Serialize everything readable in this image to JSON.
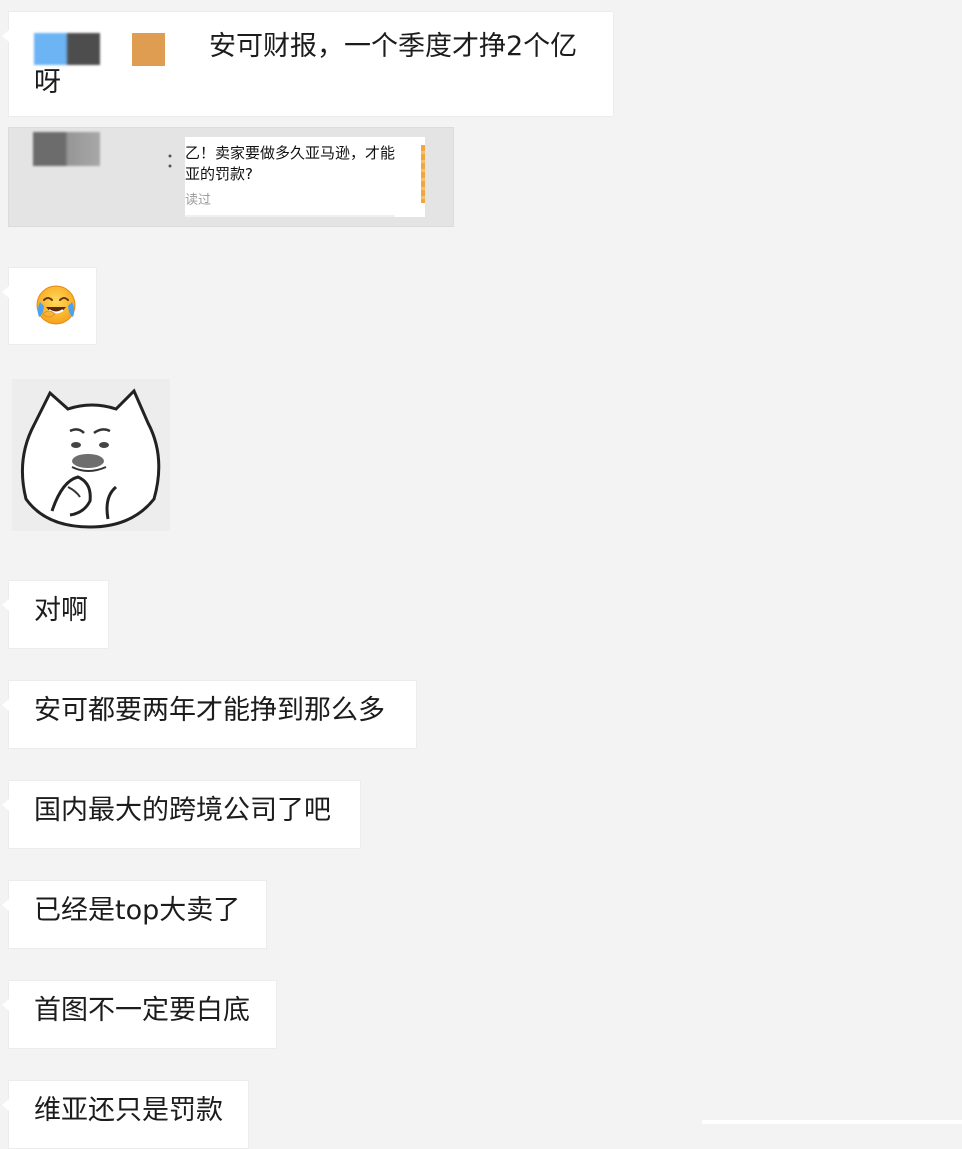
{
  "messages": {
    "m1": {
      "text_part1": "安可财报，一个季度才挣2个亿",
      "text_part2": "呀"
    },
    "link_card": {
      "title_line1": "乙！卖家要做多久亚马逊，才能",
      "title_line2": "亚的罚款?",
      "read_label": "读过",
      "colon": "："
    },
    "emoji": {
      "name": "face-with-tears-of-joy-icon"
    },
    "sticker": {
      "name": "cat-thinking-sticker"
    },
    "m2": {
      "text": "对啊"
    },
    "m3": {
      "text": "安可都要两年才能挣到那么多"
    },
    "m4": {
      "text": "国内最大的跨境公司了吧"
    },
    "m5": {
      "text": "已经是top大卖了"
    },
    "m6": {
      "text": "首图不一定要白底"
    },
    "m7": {
      "text": "维亚还只是罚款"
    }
  },
  "colors": {
    "background": "#f3f3f3",
    "bubble": "#ffffff",
    "link_card_bg": "#e4e4e4",
    "redact_blue": "#6db4f4",
    "redact_orange": "#df9d52"
  }
}
